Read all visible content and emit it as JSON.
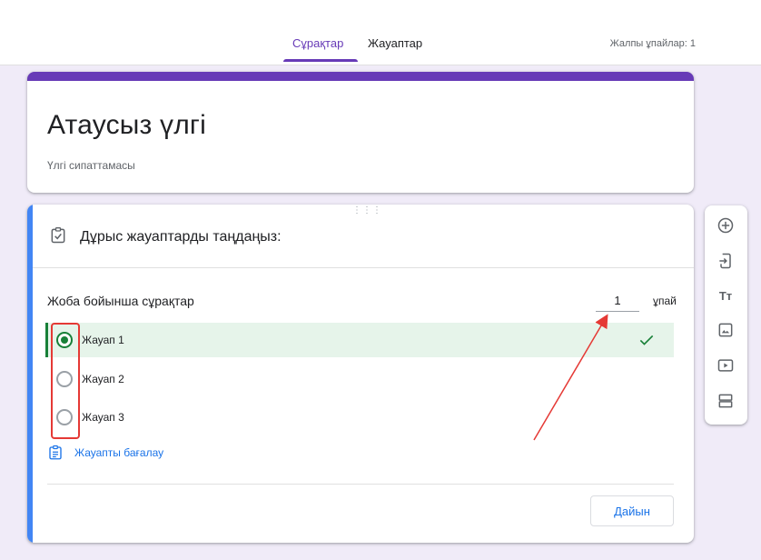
{
  "header": {
    "tabs": [
      {
        "label": "Сұрақтар",
        "active": true
      },
      {
        "label": "Жауаптар",
        "active": false
      }
    ],
    "total_points": "Жалпы ұпайлар: 1"
  },
  "form": {
    "title": "Атаусыз үлгі",
    "description": "Үлгі сипаттамасы"
  },
  "question": {
    "header": "Дұрыс жауаптарды таңдаңыз:",
    "title": "Жоба бойынша сұрақтар",
    "points_value": "1",
    "points_label": "ұпай",
    "options": [
      {
        "label": "Жауап 1",
        "selected": true,
        "correct": true
      },
      {
        "label": "Жауап 2",
        "selected": false,
        "correct": false
      },
      {
        "label": "Жауап 3",
        "selected": false,
        "correct": false
      }
    ],
    "feedback_link": "Жауапты бағалау",
    "done_button": "Дайын"
  },
  "toolbar": {
    "items": [
      "add-question-icon",
      "import-questions-icon",
      "add-title-icon",
      "add-image-icon",
      "add-video-icon",
      "add-section-icon"
    ]
  },
  "colors": {
    "accent": "#673ab7",
    "question_accent": "#4285f4",
    "correct_green": "#188038",
    "link_blue": "#1a73e8",
    "annotation_red": "#e53935"
  }
}
